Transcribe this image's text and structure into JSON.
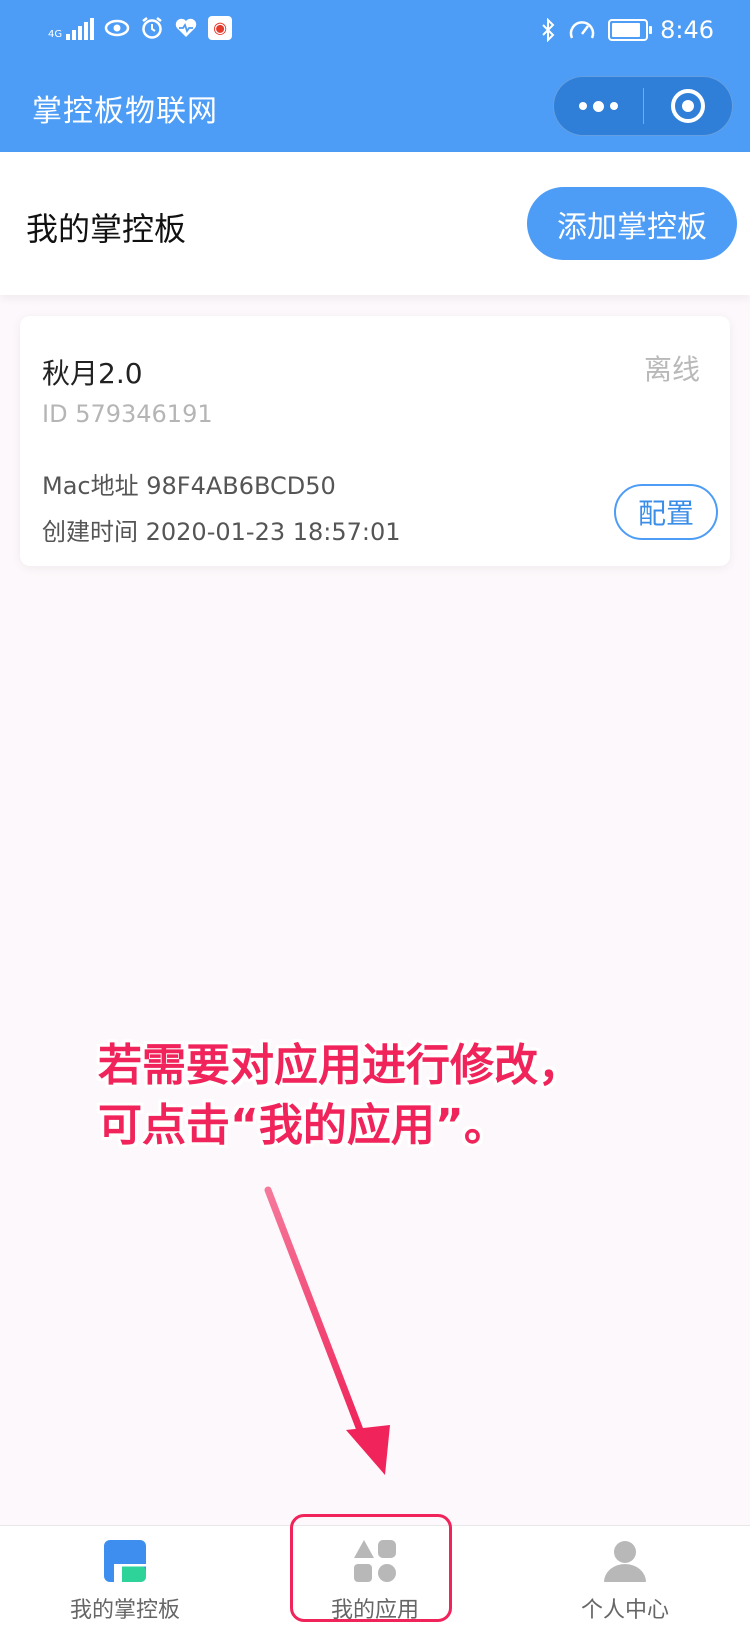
{
  "statusbar": {
    "network": "4G",
    "time": "8:46"
  },
  "titlebar": {
    "title": "掌控板物联网"
  },
  "header": {
    "title": "我的掌控板",
    "add_button": "添加掌控板"
  },
  "device": {
    "name": "秋月2.0",
    "status": "离线",
    "id": "ID 579346191",
    "mac": "Mac地址 98F4AB6BCD50",
    "created": "创建时间 2020-01-23 18:57:01",
    "config_button": "配置"
  },
  "annotation": {
    "line1": "若需要对应用进行修改，",
    "line2": "可点击“我的应用”。",
    "color": "#f0245a"
  },
  "tabbar": {
    "tabs": [
      {
        "label": "我的掌控板",
        "icon": "board-icon"
      },
      {
        "label": "我的应用",
        "icon": "apps-icon"
      },
      {
        "label": "个人中心",
        "icon": "person-icon"
      }
    ]
  },
  "colors": {
    "primary": "#4d9cf5",
    "accent": "#f0245a"
  }
}
